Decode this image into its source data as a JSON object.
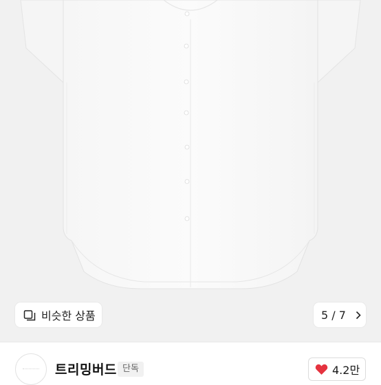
{
  "product_image": {
    "alt_subject": "shirt-photo",
    "background_color": "#f1f1f1"
  },
  "similar_products": {
    "label": "비슷한 상품",
    "icon": "similar-items-icon"
  },
  "pager": {
    "text": "5 / 7",
    "icon": "chevron-right-icon"
  },
  "seller": {
    "name": "트리밍버드",
    "badge": "단독",
    "avatar": "avatar"
  },
  "likes": {
    "count": "4.2만",
    "icon": "heart-icon",
    "color": "#e5333f"
  }
}
